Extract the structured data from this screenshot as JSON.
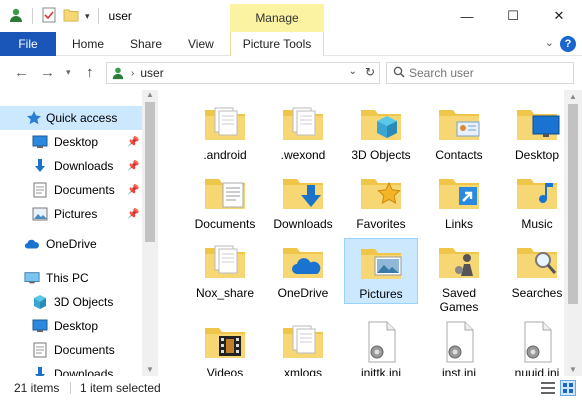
{
  "window": {
    "title": "user",
    "context_tab": "Manage",
    "controls": {
      "minimize": "—",
      "maximize": "☐",
      "close": "✕"
    }
  },
  "ribbon": {
    "file": "File",
    "tabs": [
      "Home",
      "Share",
      "View",
      "Picture Tools"
    ]
  },
  "address": {
    "crumb": "user",
    "search_placeholder": "Search user"
  },
  "nav": {
    "items": [
      {
        "label": "Quick access",
        "icon": "star-icon",
        "pinned": false
      },
      {
        "label": "Desktop",
        "icon": "desktop-icon",
        "pinned": true
      },
      {
        "label": "Downloads",
        "icon": "download-icon",
        "pinned": true
      },
      {
        "label": "Documents",
        "icon": "document-icon",
        "pinned": true
      },
      {
        "label": "Pictures",
        "icon": "picture-icon",
        "pinned": true
      },
      {
        "label": "OneDrive",
        "icon": "cloud-icon",
        "pinned": false
      },
      {
        "label": "This PC",
        "icon": "pc-icon",
        "pinned": false
      },
      {
        "label": "3D Objects",
        "icon": "cube-icon",
        "pinned": false
      },
      {
        "label": "Desktop",
        "icon": "desktop-icon",
        "pinned": false
      },
      {
        "label": "Documents",
        "icon": "document-icon",
        "pinned": false
      },
      {
        "label": "Downloads",
        "icon": "download-icon",
        "pinned": false
      }
    ]
  },
  "files": [
    {
      "name": ".android",
      "type": "folder-docs"
    },
    {
      "name": ".wexond",
      "type": "folder-docs"
    },
    {
      "name": "3D Objects",
      "type": "folder-3d"
    },
    {
      "name": "Contacts",
      "type": "folder-contacts"
    },
    {
      "name": "Desktop",
      "type": "folder-desktop"
    },
    {
      "name": "Documents",
      "type": "folder-documents"
    },
    {
      "name": "Downloads",
      "type": "folder-downloads"
    },
    {
      "name": "Favorites",
      "type": "folder-favorites"
    },
    {
      "name": "Links",
      "type": "folder-links"
    },
    {
      "name": "Music",
      "type": "folder-music"
    },
    {
      "name": "Nox_share",
      "type": "folder-docs"
    },
    {
      "name": "OneDrive",
      "type": "folder-onedrive"
    },
    {
      "name": "Pictures",
      "type": "folder-pictures",
      "selected": true
    },
    {
      "name": "Saved\nGames",
      "type": "folder-games"
    },
    {
      "name": "Searches",
      "type": "folder-searches"
    },
    {
      "name": "Videos",
      "type": "folder-videos"
    },
    {
      "name": "xmlogs",
      "type": "folder-docs"
    },
    {
      "name": "jnittk.ini",
      "type": "file-ini"
    },
    {
      "name": "inst.ini",
      "type": "file-ini"
    },
    {
      "name": "nuuid.ini",
      "type": "file-ini"
    }
  ],
  "status": {
    "count": "21 items",
    "selected": "1 item selected"
  },
  "colors": {
    "file_tab": "#1a56b8",
    "manage_tab": "#fbf3a2",
    "selection": "#cce8ff",
    "folder": "#f7d774"
  }
}
